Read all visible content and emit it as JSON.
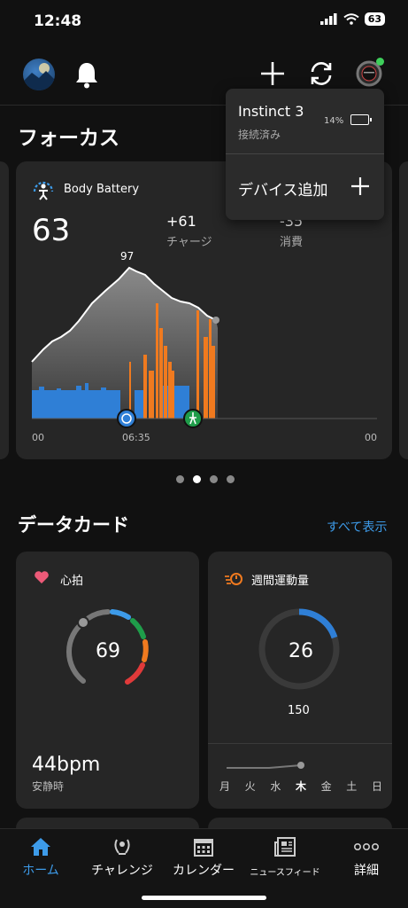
{
  "status": {
    "time": "12:48",
    "battery": "63"
  },
  "header": {
    "avatar": "avatar",
    "icons": [
      "bell-icon",
      "plus-icon",
      "sync-icon",
      "watch-icon"
    ],
    "accent": "#3ecf5b"
  },
  "dropdown": {
    "device_name": "Instinct 3",
    "device_status": "接続済み",
    "battery_pct": "14%",
    "add_device": "デバイス追加"
  },
  "focus": {
    "title": "フォーカス",
    "body_battery": {
      "title": "Body Battery",
      "value": "63",
      "charge_value": "+61",
      "charge_label": "チャージ",
      "use_value": "-35",
      "use_label": "消費",
      "peak": "97",
      "time_labels": [
        "00",
        "06:35",
        "00"
      ]
    },
    "page_dots": 4,
    "active_dot": 1
  },
  "data_cards": {
    "title": "データカード",
    "show_all": "すべて表示",
    "heart_rate": {
      "title": "心拍",
      "value": "69",
      "resting": "44bpm",
      "resting_label": "安静時"
    },
    "weekly_activity": {
      "title": "週間運動量",
      "value": "26",
      "goal": "150",
      "days": [
        "月",
        "火",
        "水",
        "木",
        "金",
        "土",
        "日"
      ],
      "current_day": "木"
    }
  },
  "colors": {
    "accent": "#3d9be9",
    "orange": "#f07a1f",
    "blue": "#2f7fd6",
    "green": "#1f9d4a",
    "red": "#e03a3a"
  },
  "tabs": [
    {
      "label": "ホーム",
      "icon": "home-icon",
      "active": true
    },
    {
      "label": "チャレンジ",
      "icon": "laurel-icon",
      "active": false
    },
    {
      "label": "カレンダー",
      "icon": "calendar-icon",
      "active": false
    },
    {
      "label": "ニュースフィード",
      "icon": "news-icon",
      "active": false
    },
    {
      "label": "詳細",
      "icon": "more-icon",
      "active": false
    }
  ]
}
